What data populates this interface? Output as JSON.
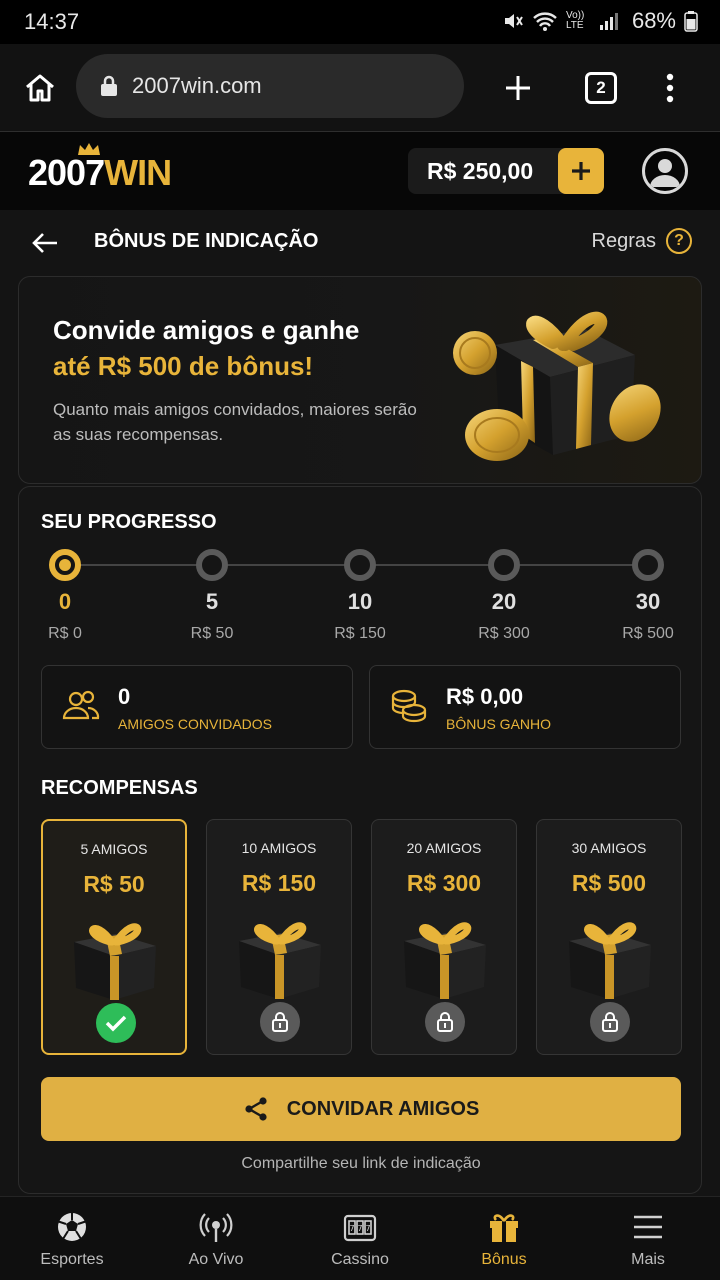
{
  "status_bar": {
    "time": "14:37",
    "battery": "68%",
    "network": "Vo)) LTE"
  },
  "browser": {
    "url": "2007win.com",
    "tab_count": "2"
  },
  "header": {
    "logo_number": "2007",
    "logo_word": "WIN",
    "balance": "R$ 250,00"
  },
  "page": {
    "title": "BÔNUS DE INDICAÇÃO",
    "rules_label": "Regras",
    "rules_icon": "?"
  },
  "hero": {
    "title": "Convide amigos e ganhe",
    "highlight": "até R$ 500 de bônus!",
    "description": "Quanto mais amigos convidados, maiores serão as suas recompensas."
  },
  "progress": {
    "title": "SEU PROGRESSO",
    "steps": [
      {
        "count": "0",
        "value": "R$ 0"
      },
      {
        "count": "5",
        "value": "R$ 50"
      },
      {
        "count": "10",
        "value": "R$ 150"
      },
      {
        "count": "20",
        "value": "R$ 300"
      },
      {
        "count": "30",
        "value": "R$ 500"
      }
    ],
    "current_step": 0
  },
  "stats": {
    "friends_value": "0",
    "friends_label": "AMIGOS CONVIDADOS",
    "bonus_value": "R$ 0,00",
    "bonus_label": "BÔNUS GANHO"
  },
  "rewards": {
    "title": "RECOMPENSAS",
    "items": [
      {
        "label": "5 AMIGOS",
        "amount": "R$ 50",
        "status": "achieved"
      },
      {
        "label": "10 AMIGOS",
        "amount": "R$ 150",
        "status": "locked"
      },
      {
        "label": "20 AMIGOS",
        "amount": "R$ 300",
        "status": "locked"
      },
      {
        "label": "30 AMIGOS",
        "amount": "R$ 500",
        "status": "locked"
      }
    ]
  },
  "invite": {
    "button_label": "CONVIDAR AMIGOS",
    "share_text": "Compartilhe seu link de indicação"
  },
  "nav": {
    "items": [
      {
        "label": "Esportes",
        "icon": "soccer-ball-icon"
      },
      {
        "label": "Ao Vivo",
        "icon": "live-broadcast-icon"
      },
      {
        "label": "Cassino",
        "icon": "slot-machine-icon"
      },
      {
        "label": "Bônus",
        "icon": "gift-icon"
      },
      {
        "label": "Mais",
        "icon": "hamburger-menu-icon"
      }
    ],
    "active": "Bônus"
  },
  "colors": {
    "accent": "#e8b43a",
    "success": "#2ebd59",
    "background": "#141414"
  }
}
